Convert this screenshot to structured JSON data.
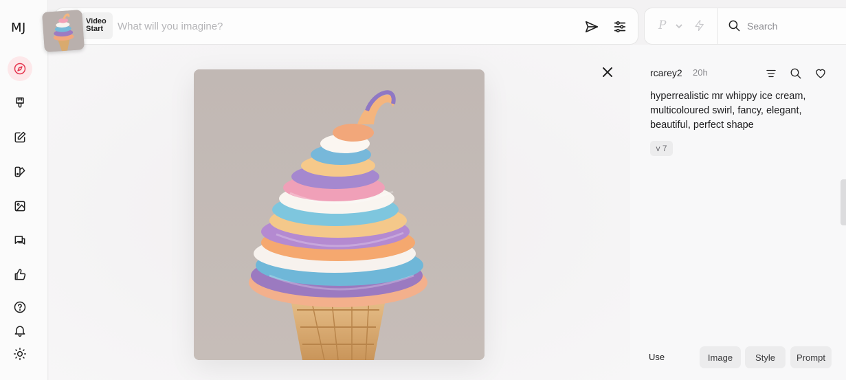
{
  "app": {
    "logo": "MJ"
  },
  "sidebar": {
    "items": [
      {
        "name": "explore",
        "icon": "compass-icon",
        "active": true
      },
      {
        "name": "create",
        "icon": "paintbrush-icon"
      },
      {
        "name": "edit",
        "icon": "edit-icon"
      },
      {
        "name": "personalize",
        "icon": "palette-icon"
      },
      {
        "name": "organize",
        "icon": "image-icon"
      },
      {
        "name": "chat",
        "icon": "chat-icon"
      },
      {
        "name": "tasks",
        "icon": "thumbs-up-icon"
      },
      {
        "name": "help",
        "icon": "help-icon"
      },
      {
        "name": "updates",
        "icon": "bell-icon"
      },
      {
        "name": "theme",
        "icon": "sun-icon"
      }
    ],
    "accent": "#e5364f"
  },
  "prompt_bar": {
    "video_start_line1": "Video",
    "video_start_line2": "Start",
    "placeholder": "What will you imagine?",
    "send_icon": "send-icon",
    "settings_icon": "sliders-icon"
  },
  "top_right": {
    "personalize_mark": "P",
    "search_placeholder": "Search"
  },
  "detail": {
    "author": "rcarey2",
    "age": "20h",
    "prompt": "hyperrealistic mr whippy ice cream, multicoloured swirl, fancy, elegant, beautiful, perfect shape",
    "version": "v 7",
    "use_label": "Use",
    "use_buttons": {
      "image": "Image",
      "style": "Style",
      "prompt": "Prompt"
    }
  }
}
